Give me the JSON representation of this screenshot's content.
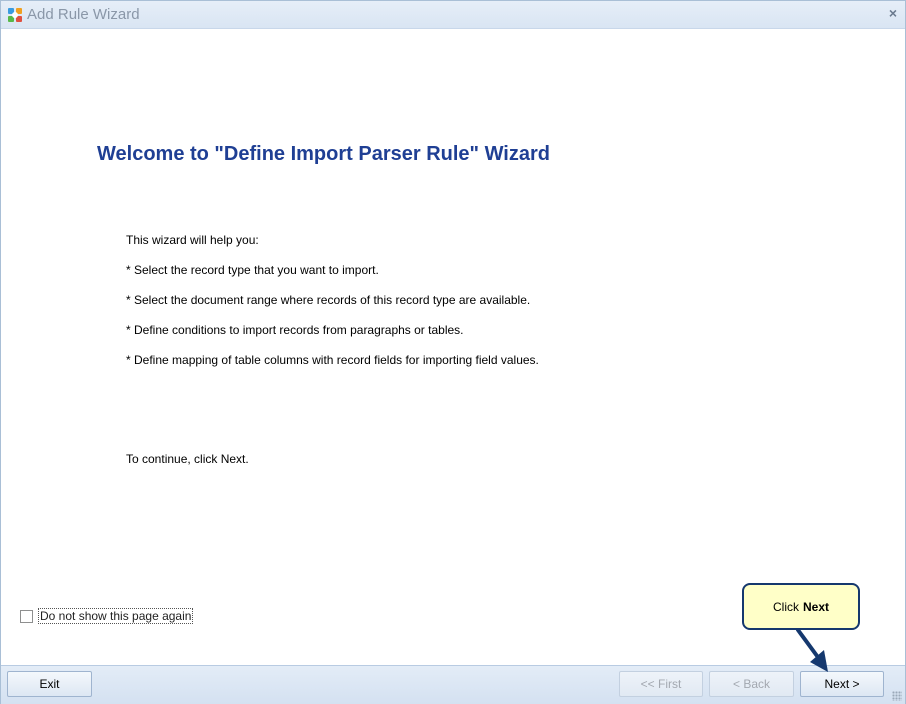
{
  "window": {
    "title": "Add Rule Wizard",
    "close_glyph": "×"
  },
  "content": {
    "heading": "Welcome to \"Define Import Parser Rule\" Wizard",
    "lines": [
      "This wizard will help you:",
      "* Select the record type that you want to import.",
      "* Select the document range where records of this record type are available.",
      "* Define conditions to import records from paragraphs or tables.",
      "* Define mapping of table columns with record fields for importing field values."
    ],
    "continue_text": "To continue, click Next."
  },
  "checkbox": {
    "label": "Do not show this page again",
    "checked": false
  },
  "footer": {
    "exit_label": "Exit",
    "first_label": "<< First",
    "back_label": "< Back",
    "next_label": "Next >"
  },
  "callout": {
    "prefix": "Click",
    "emphasis": "Next",
    "border_color": "#15386e",
    "fill_color": "#ffffc8"
  },
  "icons": {
    "app": "app-logo-icon",
    "close": "close-icon",
    "grip": "resize-grip-icon"
  }
}
